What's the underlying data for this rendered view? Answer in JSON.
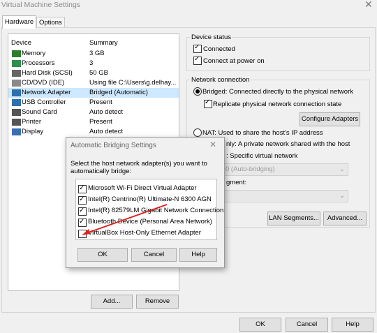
{
  "window": {
    "title": "Virtual Machine Settings"
  },
  "tabs": [
    {
      "label": "Hardware"
    },
    {
      "label": "Options"
    }
  ],
  "device_list": {
    "headers": {
      "device": "Device",
      "summary": "Summary"
    },
    "rows": [
      {
        "name": "Memory",
        "summary": "3 GB",
        "icon": "memory-icon",
        "color": "#2d7d2d"
      },
      {
        "name": "Processors",
        "summary": "3",
        "icon": "processor-icon",
        "color": "#2f8f4e"
      },
      {
        "name": "Hard Disk (SCSI)",
        "summary": "50 GB",
        "icon": "hard-disk-icon",
        "color": "#666666"
      },
      {
        "name": "CD/DVD (IDE)",
        "summary": "Using file C:\\Users\\g.delhay...",
        "icon": "cd-dvd-icon",
        "color": "#8a8a8a"
      },
      {
        "name": "Network Adapter",
        "summary": "Bridged (Automatic)",
        "icon": "network-adapter-icon",
        "color": "#2f6fb0"
      },
      {
        "name": "USB Controller",
        "summary": "Present",
        "icon": "usb-icon",
        "color": "#2f6fb0"
      },
      {
        "name": "Sound Card",
        "summary": "Auto detect",
        "icon": "sound-card-icon",
        "color": "#555555"
      },
      {
        "name": "Printer",
        "summary": "Present",
        "icon": "printer-icon",
        "color": "#555555"
      },
      {
        "name": "Display",
        "summary": "Auto detect",
        "icon": "display-icon",
        "color": "#3a6fb0"
      }
    ],
    "selected_index": 4
  },
  "buttons": {
    "add": "Add...",
    "remove": "Remove",
    "ok": "OK",
    "cancel": "Cancel",
    "help": "Help"
  },
  "device_status": {
    "label": "Device status",
    "connected": "Connected",
    "connect_at_power_on": "Connect at power on"
  },
  "network_connection": {
    "label": "Network connection",
    "bridged": "Bridged: Connected directly to the physical network",
    "replicate": "Replicate physical network connection state",
    "configure_adapters": "Configure Adapters",
    "nat": "NAT: Used to share the host's IP address",
    "host_only_partial": "nly: A private network shared with the host",
    "custom_partial": ": Specific virtual network",
    "vmnet_dropdown": "0 (Auto-bridging)",
    "segment_label_partial": "gment:",
    "lan_segments": "LAN Segments...",
    "advanced": "Advanced..."
  },
  "bridging_dialog": {
    "title": "Automatic Bridging Settings",
    "instruction_line1": "Select the host network adapter(s) you want to",
    "instruction_line2": "automatically bridge:",
    "adapters": [
      {
        "label": "Microsoft Wi-Fi Direct Virtual Adapter",
        "checked": true
      },
      {
        "label": "Intel(R) Centrino(R) Ultimate-N 6300 AGN",
        "checked": true
      },
      {
        "label": "Intel(R) 82579LM Gigabit Network Connection",
        "checked": true
      },
      {
        "label": "Bluetooth Device (Personal Area Network)",
        "checked": true
      },
      {
        "label": "VirtualBox Host-Only Ethernet Adapter",
        "checked": false
      }
    ],
    "ok": "OK",
    "cancel": "Cancel",
    "help": "Help"
  },
  "colors": {
    "selection": "#cde8ff",
    "accent": "#0078d7",
    "arrow": "#e0201b"
  }
}
